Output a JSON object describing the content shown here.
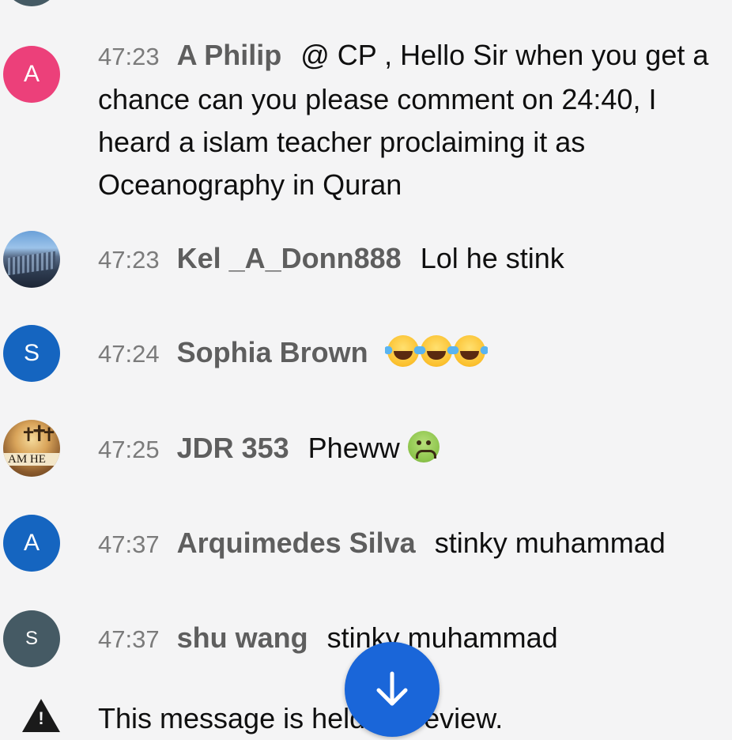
{
  "messages": [
    {
      "time": "47:23",
      "author": "A Philip",
      "text": "@ CP , Hello Sir when you get a chance can you please comment on 24:40, I heard a islam teacher proclaiming it as Oceanography in Quran",
      "avatar": {
        "type": "letter",
        "letter": "A",
        "color": "#ec407a"
      }
    },
    {
      "time": "47:23",
      "author": "Kel _A_Donn888",
      "text": "Lol he stink",
      "avatar": {
        "type": "photo",
        "subject": "city-skyline"
      }
    },
    {
      "time": "47:24",
      "author": "Sophia Brown",
      "text": "",
      "emoji": [
        "face-with-tears-of-joy",
        "face-with-tears-of-joy",
        "face-with-tears-of-joy"
      ],
      "avatar": {
        "type": "letter",
        "letter": "S",
        "color": "#1565c0"
      }
    },
    {
      "time": "47:25",
      "author": "JDR 353",
      "text": "Pheww",
      "emoji": [
        "nauseated-face"
      ],
      "avatar": {
        "type": "photo",
        "subject": "three-crosses",
        "caption": "AM HE"
      }
    },
    {
      "time": "47:37",
      "author": "Arquimedes Silva",
      "text": "stinky muhammad",
      "avatar": {
        "type": "letter",
        "letter": "A",
        "color": "#1565c0"
      }
    },
    {
      "time": "47:37",
      "author": "shu wang",
      "text": "stinky muhammad",
      "avatar": {
        "type": "letter",
        "letter": "S",
        "color": "#455a64"
      }
    }
  ],
  "held_message": {
    "text": "This message is held for review.",
    "icon": "warning-icon"
  },
  "scroll_to_bottom": {
    "icon": "arrow-down-icon",
    "color": "#1a66d9"
  }
}
